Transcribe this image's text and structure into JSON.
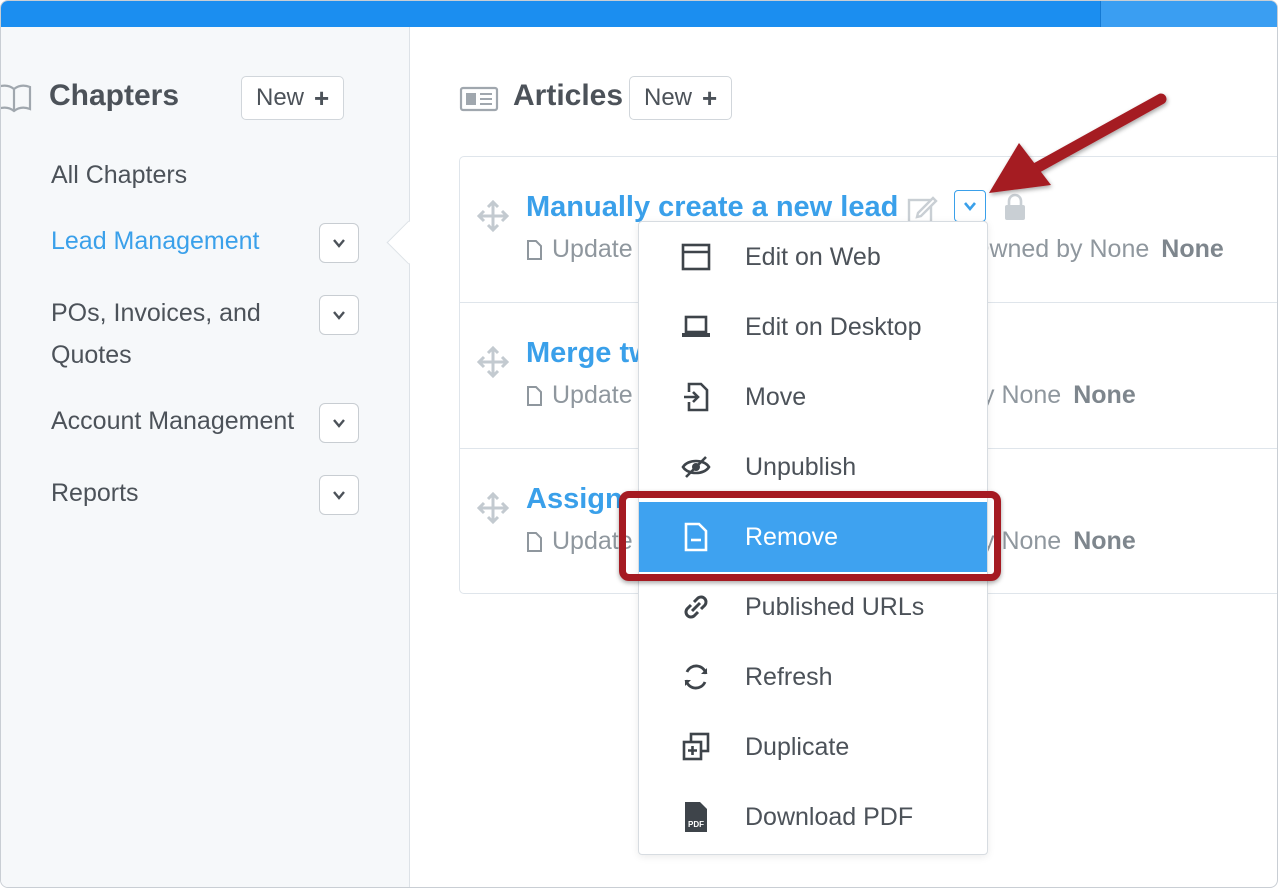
{
  "sidebar": {
    "title": "Chapters",
    "new_button": "New",
    "items": [
      {
        "label": "All Chapters"
      },
      {
        "label": "Lead Management"
      },
      {
        "label": "POs, Invoices, and Quotes"
      },
      {
        "label": "Account Management"
      },
      {
        "label": "Reports"
      }
    ]
  },
  "articles": {
    "title": "Articles",
    "new_button": "New",
    "rows": [
      {
        "title": "Manually create a new lead",
        "meta": "Update",
        "owner": "Owned by None",
        "owner_value": "None"
      },
      {
        "title": "Merge tw",
        "meta": "Update",
        "owner": "y None",
        "owner_value": "None"
      },
      {
        "title": "Assign",
        "meta": "Update",
        "owner": "y None",
        "owner_value": "None"
      }
    ]
  },
  "menu": {
    "items": [
      {
        "label": "Edit on Web",
        "icon": "browser-window-icon"
      },
      {
        "label": "Edit on Desktop",
        "icon": "laptop-icon"
      },
      {
        "label": "Move",
        "icon": "move-file-icon"
      },
      {
        "label": "Unpublish",
        "icon": "eye-slash-icon"
      },
      {
        "label": "Remove",
        "icon": "remove-file-icon",
        "selected": true
      },
      {
        "label": "Published URLs",
        "icon": "link-icon"
      },
      {
        "label": "Refresh",
        "icon": "refresh-icon"
      },
      {
        "label": "Duplicate",
        "icon": "duplicate-icon"
      },
      {
        "label": "Download PDF",
        "icon": "pdf-file-icon"
      }
    ]
  },
  "colors": {
    "accent": "#3aa0ea",
    "topbar": "#1b8ef0",
    "annotation": "#a51a22"
  }
}
